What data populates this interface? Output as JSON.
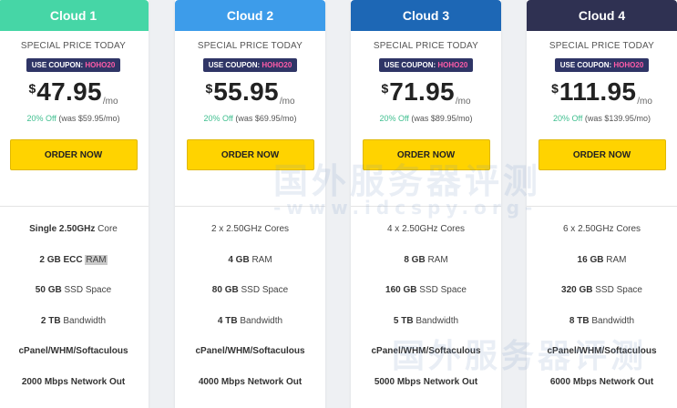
{
  "colors": {
    "cloud1": "#46d6a6",
    "cloud2": "#3d9cea",
    "cloud3": "#1d67b5",
    "cloud4": "#2f3152",
    "order_button": "#ffd300",
    "coupon_bg": "#2f3566",
    "coupon_code": "#ff5ca8",
    "discount_green": "#3fbf8f"
  },
  "watermark": {
    "main": "国外服务器评测",
    "url": "-www.idcspy.org-"
  },
  "plans": [
    {
      "name": "Cloud 1",
      "special": "SPECIAL PRICE TODAY",
      "coupon_label": "USE COUPON:",
      "coupon_code": "HOHO20",
      "currency": "$",
      "price": "47.95",
      "period": "/mo",
      "off": "20% Off",
      "was": "(was $59.95/mo)",
      "order": "ORDER NOW",
      "cores_bold": "Single 2.50GHz",
      "cores_rest": " Core",
      "ram_bold": "2 GB ECC",
      "ram_rest": "RAM",
      "ssd_bold": "50 GB",
      "ssd_rest": " SSD Space",
      "bw_bold": "2 TB",
      "bw_rest": " Bandwidth",
      "panel": "cPanel/WHM/Softaculous",
      "network": "2000 Mbps Network Out"
    },
    {
      "name": "Cloud 2",
      "special": "SPECIAL PRICE TODAY",
      "coupon_label": "USE COUPON:",
      "coupon_code": "HOHO20",
      "currency": "$",
      "price": "55.95",
      "period": "/mo",
      "off": "20% Off",
      "was": "(was $69.95/mo)",
      "order": "ORDER NOW",
      "cores_bold": "2 x 2.50GHz",
      "cores_rest": " Cores",
      "ram_bold": "4 GB",
      "ram_rest": " RAM",
      "ssd_bold": "80 GB",
      "ssd_rest": " SSD Space",
      "bw_bold": "4 TB",
      "bw_rest": " Bandwidth",
      "panel": "cPanel/WHM/Softaculous",
      "network": "4000 Mbps Network Out"
    },
    {
      "name": "Cloud 3",
      "special": "SPECIAL PRICE TODAY",
      "coupon_label": "USE COUPON:",
      "coupon_code": "HOHO20",
      "currency": "$",
      "price": "71.95",
      "period": "/mo",
      "off": "20% Off",
      "was": "(was $89.95/mo)",
      "order": "ORDER NOW",
      "cores_bold": "4 x 2.50GHz",
      "cores_rest": " Cores",
      "ram_bold": "8 GB",
      "ram_rest": " RAM",
      "ssd_bold": "160 GB",
      "ssd_rest": " SSD Space",
      "bw_bold": "5 TB",
      "bw_rest": " Bandwidth",
      "panel": "cPanel/WHM/Softaculous",
      "network": "5000 Mbps Network Out"
    },
    {
      "name": "Cloud 4",
      "special": "SPECIAL PRICE TODAY",
      "coupon_label": "USE COUPON:",
      "coupon_code": "HOHO20",
      "currency": "$",
      "price": "111.95",
      "period": "/mo",
      "off": "20% Off",
      "was": "(was $139.95/mo)",
      "order": "ORDER NOW",
      "cores_bold": "6 x 2.50GHz",
      "cores_rest": " Cores",
      "ram_bold": "16 GB",
      "ram_rest": " RAM",
      "ssd_bold": "320 GB",
      "ssd_rest": " SSD Space",
      "bw_bold": "8 TB",
      "bw_rest": " Bandwidth",
      "panel": "cPanel/WHM/Softaculous",
      "network": "6000 Mbps Network Out"
    }
  ]
}
